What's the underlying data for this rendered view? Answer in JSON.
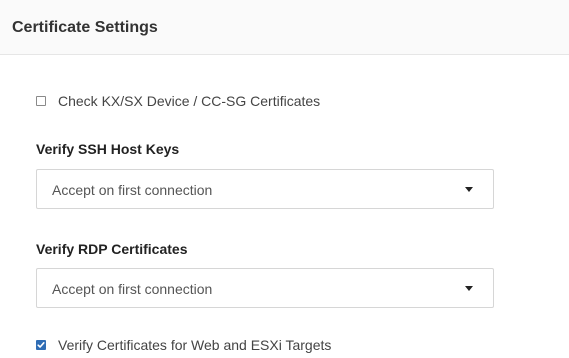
{
  "header": {
    "title": "Certificate Settings"
  },
  "options": {
    "check_device_certs": {
      "label": "Check KX/SX Device / CC-SG Certificates",
      "checked": false
    },
    "verify_web_esxi": {
      "label": "Verify Certificates for Web and ESXi Targets",
      "checked": true
    }
  },
  "ssh_host_keys": {
    "label": "Verify SSH Host Keys",
    "selected": "Accept on first connection",
    "icon": "chevron-down-icon"
  },
  "rdp_certificates": {
    "label": "Verify RDP Certificates",
    "selected": "Accept on first connection",
    "icon": "chevron-down-icon"
  },
  "colors": {
    "checkbox_checked": "#2f6db5",
    "header_background": "#fafafa"
  }
}
